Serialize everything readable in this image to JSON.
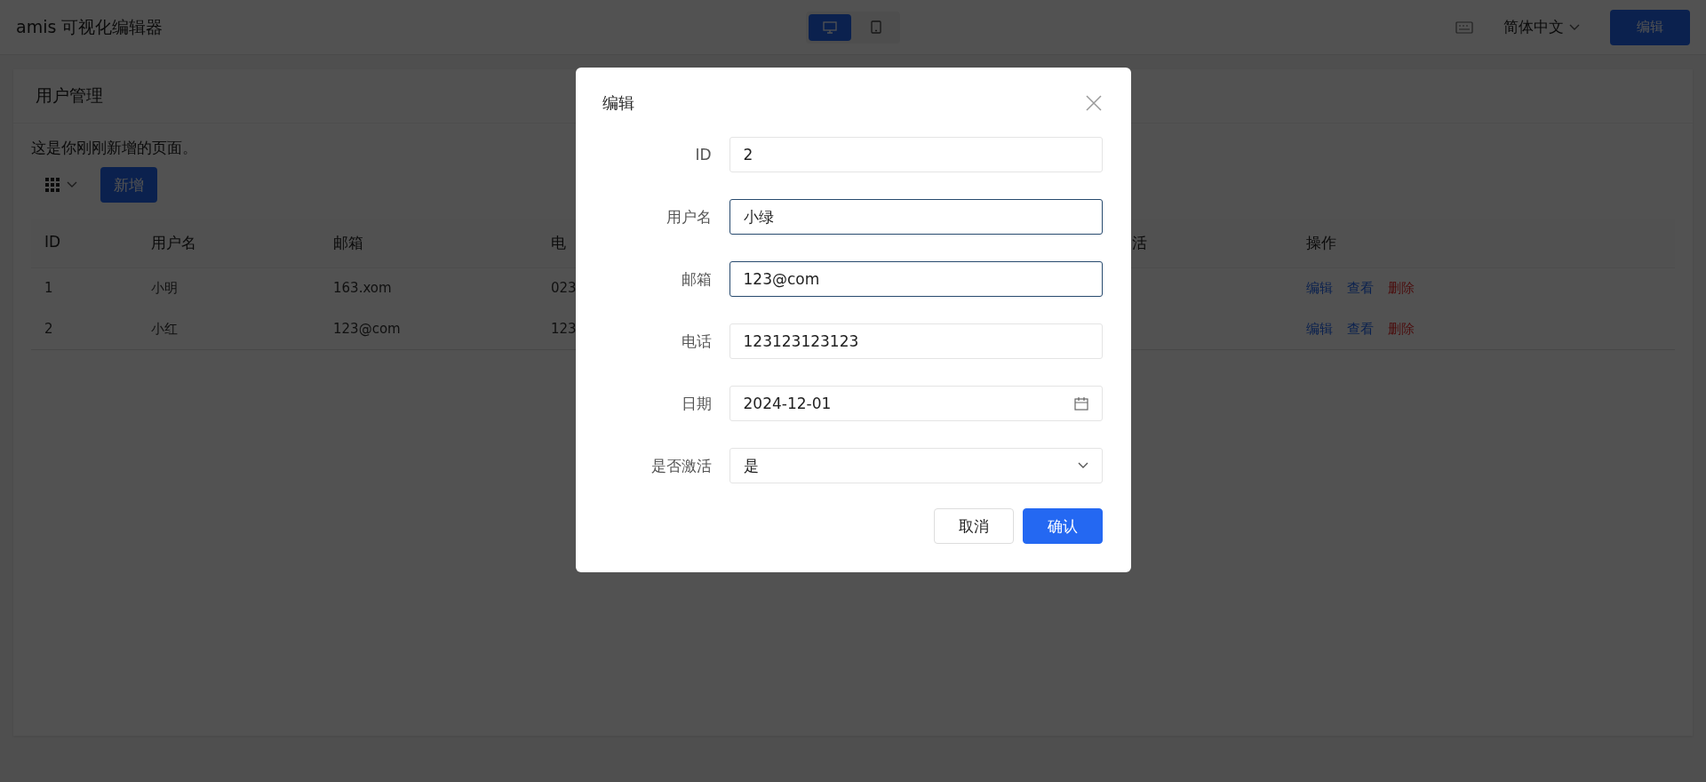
{
  "header": {
    "title": "amis 可视化编辑器",
    "device_toggle": [
      {
        "kind": "desktop",
        "selected": true
      },
      {
        "kind": "tablet",
        "selected": false
      }
    ],
    "language": "简体中文",
    "edit_button": "编辑"
  },
  "page": {
    "title": "用户管理",
    "description": "这是你刚刚新增的页面。",
    "add_button": "新增",
    "table": {
      "columns": [
        "ID",
        "用户名",
        "邮箱",
        "电",
        "活",
        "操作"
      ],
      "rows": [
        {
          "cells": [
            "1",
            "小明",
            "163.xom",
            "023"
          ],
          "actions": [
            {
              "label": "编辑",
              "kind": "link"
            },
            {
              "label": "查看",
              "kind": "link"
            },
            {
              "label": "删除",
              "kind": "danger"
            }
          ]
        },
        {
          "cells": [
            "2",
            "小红",
            "123@com",
            "123"
          ],
          "actions": [
            {
              "label": "编辑",
              "kind": "link"
            },
            {
              "label": "查看",
              "kind": "link"
            },
            {
              "label": "删除",
              "kind": "danger"
            }
          ]
        }
      ]
    }
  },
  "dialog": {
    "title": "编辑",
    "fields": [
      {
        "label": "ID",
        "value": "2",
        "kind": "text",
        "focused": false
      },
      {
        "label": "用户名",
        "value": "小绿",
        "kind": "text",
        "focused": true
      },
      {
        "label": "邮箱",
        "value": "123@com",
        "kind": "text",
        "focused": true
      },
      {
        "label": "电话",
        "value": "123123123123",
        "kind": "text",
        "focused": false
      },
      {
        "label": "日期",
        "value": "2024-12-01",
        "kind": "date",
        "focused": false
      },
      {
        "label": "是否激活",
        "value": "是",
        "kind": "select",
        "focused": false
      }
    ],
    "buttons": [
      {
        "label": "取消",
        "primary": false
      },
      {
        "label": "确认",
        "primary": true
      }
    ]
  }
}
